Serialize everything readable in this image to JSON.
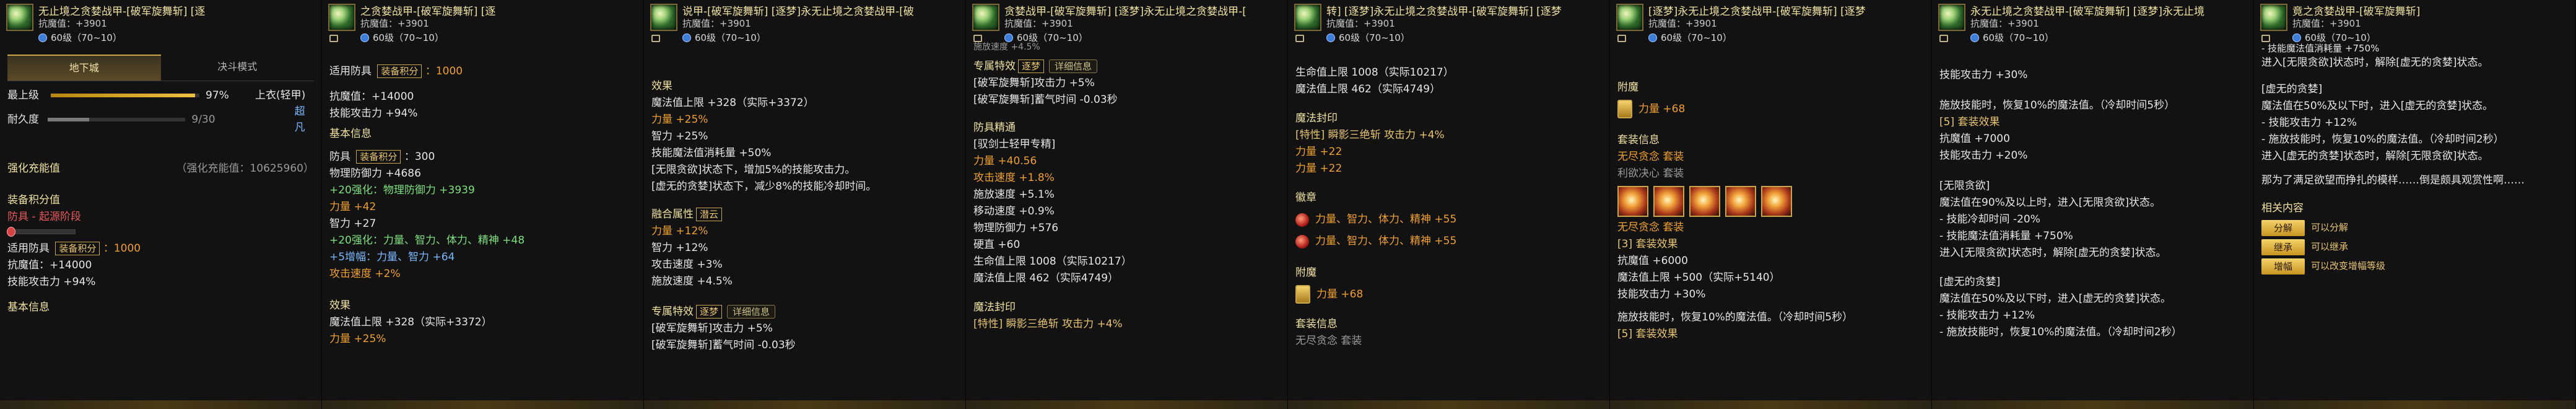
{
  "panel1": {
    "title": "无止境之贪婪战甲-[破军旋舞斩]  [逐",
    "sub": "抗魔值：+3901",
    "lvl": "60级（70~10）",
    "tabs": [
      "地下城",
      "决斗模式"
    ],
    "stats": [
      {
        "label": "最上级",
        "pct": "97%",
        "right": "上衣(轻甲)",
        "fill": 0.97
      },
      {
        "label": "耐久度",
        "pct": "9/30",
        "right": "",
        "fill": 0.3
      }
    ],
    "extra_right": "超凡",
    "upgrade_label": "强化充能值",
    "upgrade_value": "（强化充能值：10625960）",
    "set_points": "装备积分值",
    "defense_stage": "防具 - 起源阶段",
    "fit_label": "适用防具",
    "fit_tag": "装备积分",
    "fit_value": "1000",
    "resist": "抗魔值：+14000",
    "skill_atk": "技能攻击力 +94%",
    "base_info": "基本信息"
  },
  "panel2": {
    "title": "之贪婪战甲-[破军旋舞斩]  [逐",
    "sub": "抗魔值：+3901",
    "lvl": "60级（70~10）",
    "fit_label": "适用防具",
    "fit_tag": "装备积分",
    "fit_value": "1000",
    "resist": "抗魔值：+14000",
    "skill_atk": "技能攻击力 +94%",
    "base_info": "基本信息",
    "def_label": "防具",
    "def_tag": "装备积分",
    "def_value": "300",
    "phys_def": "物理防御力 +4686",
    "enh_phys": "+20强化：",
    "enh_phys_val": "物理防御力 +3939",
    "str": "力量 +42",
    "int": "智力 +27",
    "enh_all": "+20强化：",
    "enh_all_val": "力量、智力、体力、精神 +48",
    "amp": "+5增幅：",
    "amp_val": "力量、智力 +64",
    "atk_speed": "攻击速度 +2%",
    "effect": "效果",
    "mp_max": "魔法值上限 +328（实际+3372）",
    "str2": "力量 +25%"
  },
  "panel3": {
    "title": "说甲-[破军旋舞斩]  [逐梦]永无止境之贪婪战甲-[破",
    "sub": "抗魔值：+3901",
    "lvl": "60级（70~10）",
    "effect": "效果",
    "mp_max": "魔法值上限 +328（实际+3372）",
    "str": "力量 +25%",
    "int": "智力 +25%",
    "mp_cost": "技能魔法值消耗量 +50%",
    "greed1": "[无限贪欲]状态下，增加5%的技能攻击力。",
    "greed2": "[虚无的贪婪]状态下，减少8%的技能冷却时间。",
    "enchant_title": "融合属性",
    "enchant_tag": "潜云",
    "str2": "力量 +12%",
    "int2": "智力 +12%",
    "atk_speed": "攻击速度 +3%",
    "cast_speed": "施放速度 +4.5%",
    "special_title": "专属特效",
    "special_tag": "逐梦",
    "detail_btn": "详细信息",
    "sp1": "[破军旋舞斩]攻击力 +5%",
    "sp2": "[破军旋舞斩]蓄气时间 -0.03秒"
  },
  "panel4": {
    "title": "贪婪战甲-[破军旋舞斩]  [逐梦]永无止境之贪婪战甲-[",
    "sub": "抗魔值：+3901",
    "lvl": "60级（70~10）",
    "top_cut": "施放速度 +4.5%",
    "special_title": "专属特效",
    "special_tag": "逐梦",
    "detail_btn": "详细信息",
    "sp1": "[破军旋舞斩]攻击力 +5%",
    "sp2": "[破军旋舞斩]蓄气时间 -0.03秒",
    "mastery": "防具精通",
    "mastery_sub": "[驭剑士轻甲专精]",
    "str": "力量 +40.56",
    "atk_speed": "攻击速度 +1.8%",
    "cast_speed": "施放速度 +5.1%",
    "move_speed": "移动速度 +0.9%",
    "phys_def": "物理防御力 +576",
    "hard": "硬直 +60",
    "hp_max": "生命值上限 1008（实际10217）",
    "mp_max": "魔法值上限 462（实际4749）",
    "seal": "魔法封印",
    "seal_cut": "[特性] 瞬影三绝斩 攻击力 +4%"
  },
  "panel5": {
    "title": "转]  [逐梦]永无止境之贪婪战甲-[破军旋舞斩]  [逐梦",
    "sub": "抗魔值：+3901",
    "lvl": "60级（70~10）",
    "hp_max": "生命值上限 1008（实际10217）",
    "mp_max": "魔法值上限 462（实际4749）",
    "seal": "魔法封印",
    "seal_trait": "[特性] 瞬影三绝斩 攻击力 +4%",
    "str1": "力量 +22",
    "str2": "力量 +22",
    "emblem": "徽章",
    "em1": "力量、智力、体力、精神 +55",
    "em2": "力量、智力、体力、精神 +55",
    "enchant": "附魔",
    "ench_val": "力量 +68",
    "set_info": "套装信息",
    "set_cut": "无尽贪念 套装"
  },
  "panel6": {
    "title": "[逐梦]永无止境之贪婪战甲-[破军旋舞斩]  [逐梦",
    "sub": "抗魔值：+3901",
    "lvl": "60级（70~10）",
    "enchant": "附魔",
    "ench_val": "力量 +68",
    "set_info": "套装信息",
    "set_name": "无尽贪念 套装",
    "set_heart": "利欲决心 套装",
    "set_line": "无尽贪念 套装",
    "set3": "[3] 套装效果",
    "resist": "抗魔值 +6000",
    "mp_max": "魔法值上限 +500（实际+5140）",
    "skill_atk": "技能攻击力 +30%",
    "regen": "施放技能时，恢复10%的魔法值。（冷却时间5秒）",
    "set5_cut": "[5] 套装效果"
  },
  "panel7": {
    "title": "永无止境之贪婪战甲-[破军旋舞斩]  [逐梦]永无止境",
    "sub": "抗魔值：+3901",
    "lvl": "60级（70~10）",
    "skill_atk": "技能攻击力 +30%",
    "regen": "施放技能时，恢复10%的魔法值。（冷却时间5秒）",
    "set5": "[5] 套装效果",
    "resist": "抗魔值 +7000",
    "skill_atk2": "技能攻击力 +20%",
    "greed_title": "[无限贪欲]",
    "greed1": "魔法值在90%及以上时，进入[无限贪欲]状态。",
    "greed2": "- 技能冷却时间 -20%",
    "greed3": "- 技能魔法值消耗量 +750%",
    "greed4": "进入[无限贪欲]状态时，解除[虚无的贪婪]状态。",
    "void_title": "[虚无的贪婪]",
    "void1": "魔法值在50%及以下时，进入[虚无的贪婪]状态。",
    "void2": "- 技能攻击力 +12%",
    "void3": "- 施放技能时，恢复10%的魔法值。（冷却时间2秒）"
  },
  "panel8": {
    "title": "竟之贪婪战甲-[破军旋舞斩]",
    "sub": "抗魔值：+3901",
    "lvl": "60级（70~10）",
    "cut1": "- 技能魔法值消耗量 +750%",
    "cut2": "进入[无限贪欲]状态时，解除[虚无的贪婪]状态。",
    "void_title": "[虚无的贪婪]",
    "void1": "魔法值在50%及以下时，进入[虚无的贪婪]状态。",
    "void2": "- 技能攻击力 +12%",
    "void3": "- 施放技能时，恢复10%的魔法值。（冷却时间2秒）",
    "void4": "进入[虚无的贪婪]状态时，解除[无限贪欲]状态。",
    "flavor": "那为了满足欲望而挣扎的模样……倒是颇具观赏性啊……",
    "related": "相关内容",
    "actions": [
      {
        "btn": "分解",
        "desc": "可以分解"
      },
      {
        "btn": "继承",
        "desc": "可以继承"
      },
      {
        "btn": "增幅",
        "desc": "可以改变增幅等级"
      }
    ]
  }
}
